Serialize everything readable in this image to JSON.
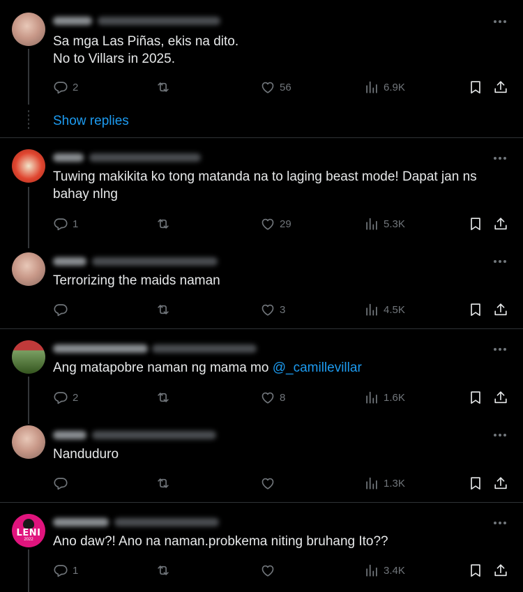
{
  "posts": [
    {
      "text": "Sa mga Las Piñas, ekis na dito.\nNo to Villars in 2025.",
      "replies": "2",
      "retweets": "",
      "likes": "56",
      "views": "6.9K"
    },
    {
      "text": "Tuwing makikita ko tong matanda na to laging beast mode! Dapat jan ns bahay nlng",
      "replies": "1",
      "retweets": "",
      "likes": "29",
      "views": "5.3K"
    },
    {
      "text": "Terrorizing the maids naman",
      "replies": "",
      "retweets": "",
      "likes": "3",
      "views": "4.5K"
    },
    {
      "text_before": "Ang matapobre naman ng mama mo ",
      "mention": "@_camillevillar",
      "replies": "2",
      "retweets": "",
      "likes": "8",
      "views": "1.6K"
    },
    {
      "text": "Nanduduro",
      "replies": "",
      "retweets": "",
      "likes": "",
      "views": "1.3K"
    },
    {
      "text": "Ano daw?! Ano na naman.probkema niting bruhang Ito??",
      "replies": "1",
      "retweets": "",
      "likes": "",
      "views": "3.4K"
    }
  ],
  "show_replies_label": "Show replies",
  "avatar_badges": {
    "leni": "LENI",
    "leni_sub": "2022"
  },
  "colors": {
    "background": "#000000",
    "text": "#e7e9ea",
    "muted": "#71767b",
    "accent": "#1d9bf0",
    "divider": "#2f3336"
  },
  "icons": {
    "reply": "reply-icon",
    "retweet": "retweet-icon",
    "like": "heart-icon",
    "views": "views-icon",
    "bookmark": "bookmark-icon",
    "share": "share-icon",
    "more": "more-icon"
  }
}
